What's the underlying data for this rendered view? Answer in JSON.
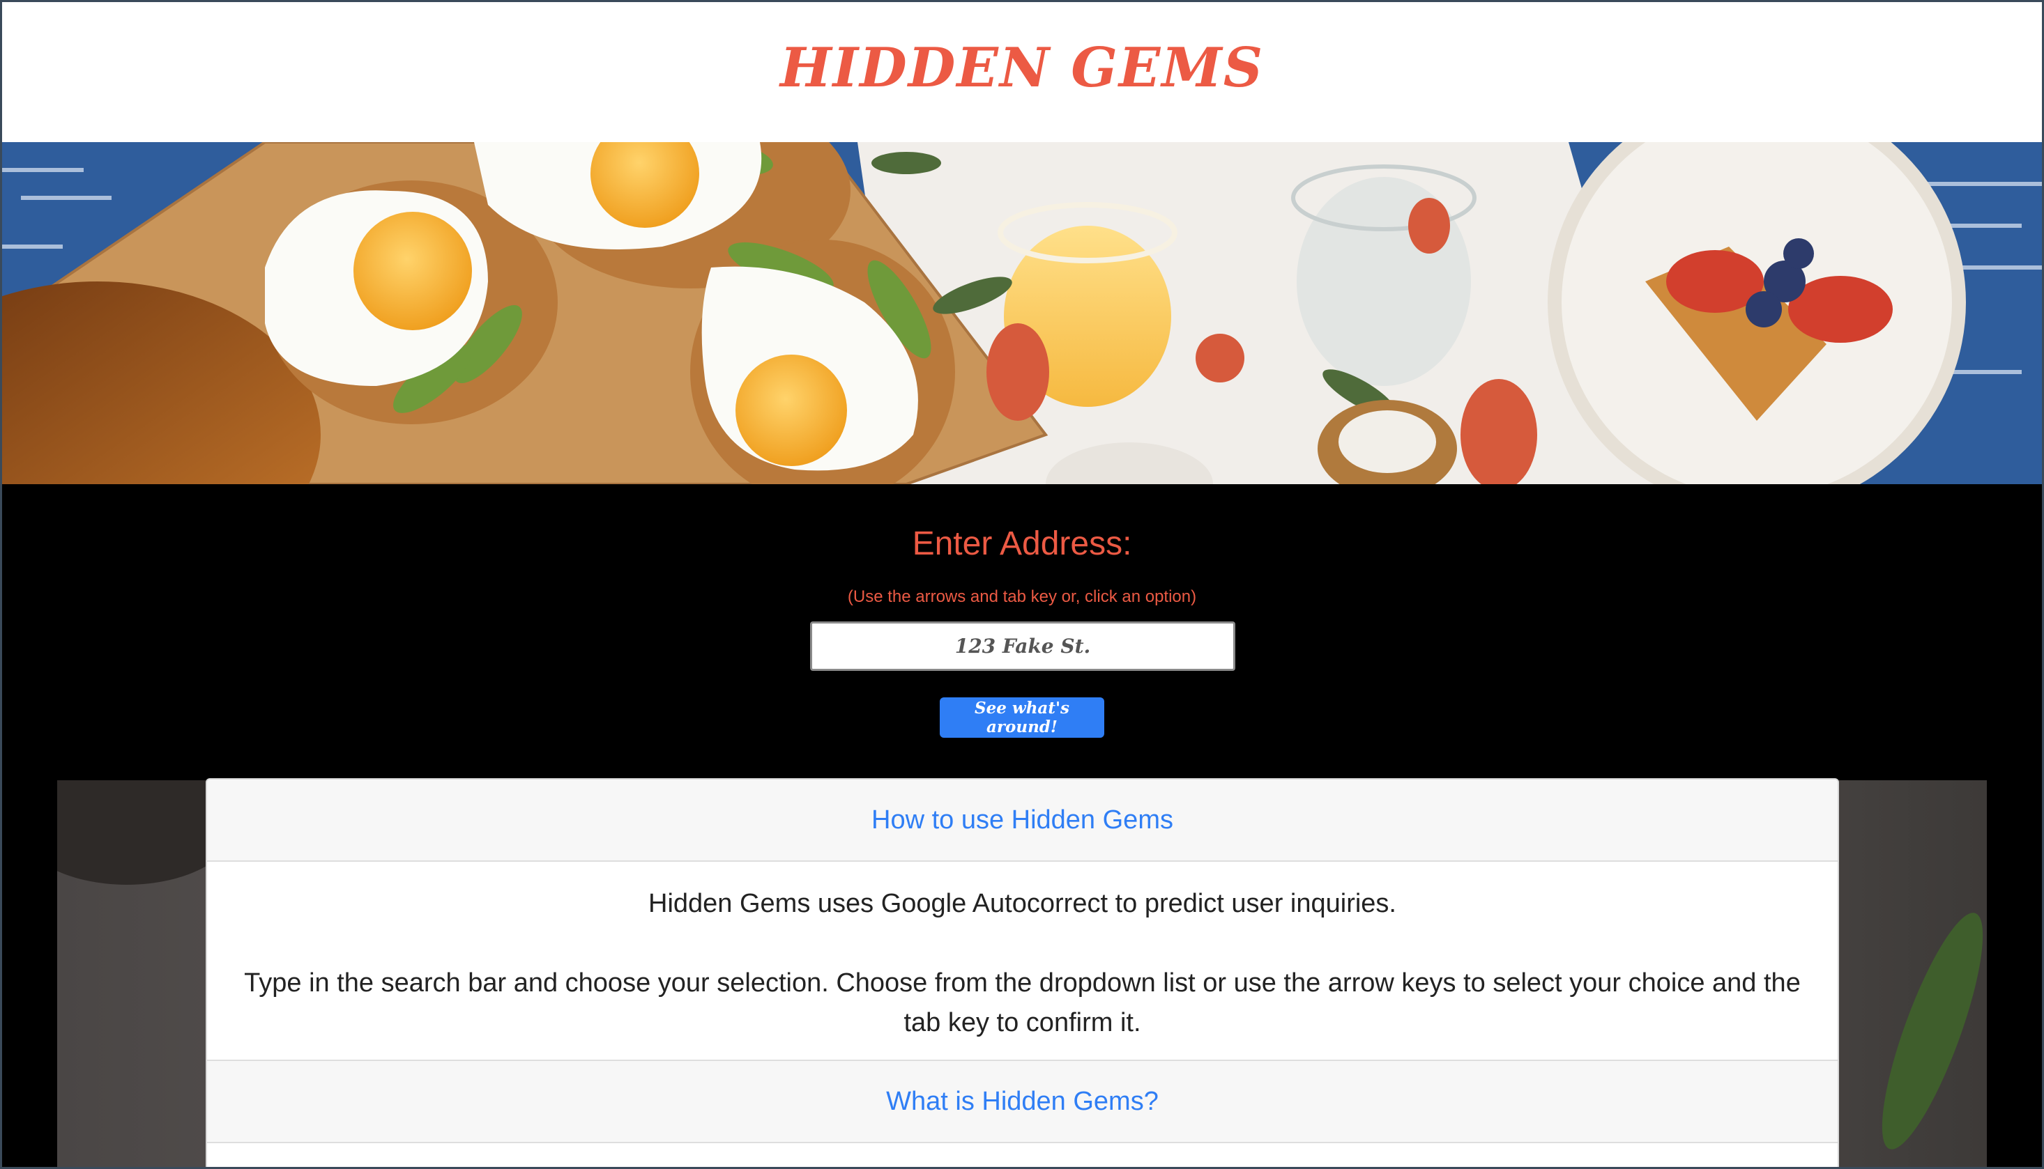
{
  "header": {
    "brand": "HIDDEN GEMS"
  },
  "hero": {
    "image_subject": "breakfast-table-photo"
  },
  "search": {
    "title": "Enter Address:",
    "hint": "(Use the arrows and tab key or, click an option)",
    "input_placeholder": "123 Fake St.",
    "input_value": "",
    "button_label": "See what's around!"
  },
  "accordion": {
    "items": [
      {
        "title": "How to use Hidden Gems",
        "expanded": true,
        "paragraphs": [
          "Hidden Gems uses Google Autocorrect to predict user inquiries.",
          "Type in the search bar and choose your selection. Choose from the dropdown list or use the arrow keys to select your choice and the tab key to confirm it."
        ]
      },
      {
        "title": "What is Hidden Gems?",
        "expanded": false
      }
    ]
  },
  "colors": {
    "brand": "#ec5a44",
    "link": "#2f7ef5",
    "button": "#2f7ef5",
    "background": "#000000"
  }
}
